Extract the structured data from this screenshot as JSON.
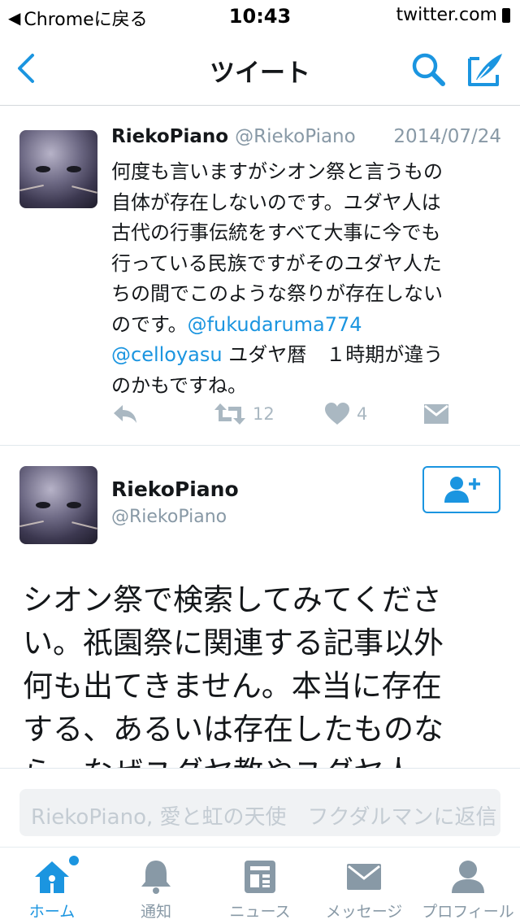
{
  "status_bar": {
    "back_app": "Chromeに戻る",
    "time": "10:43",
    "host": "twitter.com"
  },
  "nav": {
    "title": "ツイート",
    "back_icon": "chevron-left-icon",
    "search_icon": "search-icon",
    "compose_icon": "compose-tweet-icon"
  },
  "tweet1": {
    "name": "RiekoPiano",
    "handle": "@RiekoPiano",
    "date": "2014/07/24",
    "body_lines": [
      "何度も言いますがシオン祭と言うもの",
      "自体が存在しないのです。ユダヤ人は",
      "古代の行事伝統をすべて大事に今でも",
      "行っている民族ですがそのユダヤ人た",
      "ちの間でこのような祭りが存在しない"
    ],
    "line6_text": "のです。",
    "mention1": "@fukudaruma774",
    "mention2": "@celloyasu",
    "line7_text": " ユダヤ暦　１時期が違う",
    "line8_text": "のかもですね。",
    "retweet_count": "12",
    "like_count": "4"
  },
  "tweet2": {
    "name": "RiekoPiano",
    "handle": "@RiekoPiano",
    "body_lines": [
      "シオン祭で検索してみてくださ",
      "い。祇園祭に関連する記事以外",
      "何も出てきません。本当に存在",
      "する、あるいは存在したものな",
      "ら、なぜユダヤ教やユダヤ人"
    ]
  },
  "reply": {
    "placeholder": "RiekoPiano, 愛と虹の天使　フクダルマンに返信"
  },
  "tabs": [
    {
      "label": "ホーム",
      "icon": "home-icon"
    },
    {
      "label": "通知",
      "icon": "bell-icon"
    },
    {
      "label": "ニュース",
      "icon": "news-icon"
    },
    {
      "label": "メッセージ",
      "icon": "envelope-icon"
    },
    {
      "label": "プロフィール",
      "icon": "profile-icon"
    }
  ],
  "colors": {
    "accent": "#1b95e0",
    "muted": "#8899a6",
    "action_gray": "#aab8c2",
    "text": "#14171a"
  }
}
